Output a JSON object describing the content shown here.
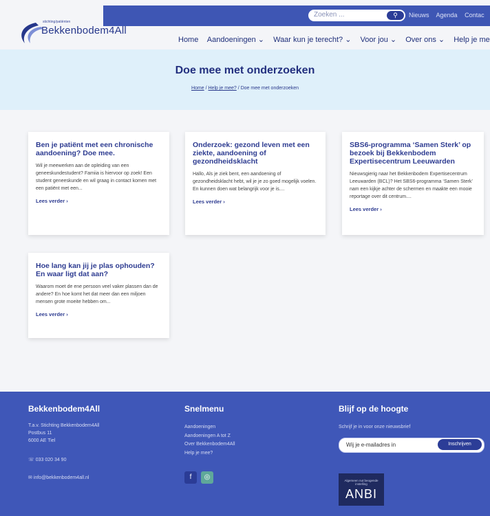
{
  "header": {
    "search_placeholder": "Zoeken ...",
    "top_links": [
      "Nieuws",
      "Agenda",
      "Contac"
    ],
    "logo_sub": "stichting/patiënten",
    "logo_text": "Bekkenbodem4All",
    "nav": [
      "Home",
      "Aandoeningen ⌄",
      "Waar kun je terecht? ⌄",
      "Voor jou ⌄",
      "Over ons ⌄",
      "Help je mee?"
    ]
  },
  "hero": {
    "title": "Doe mee met onderzoeken",
    "breadcrumb": {
      "home": "Home",
      "sep1": " / ",
      "help": "Help je mee?",
      "current": " / Doe mee met onderzoeken"
    }
  },
  "cards": [
    {
      "title": "Ben je patiënt met een chronische aandoening? Doe mee.",
      "text": "Wil je meewerken aan de opleiding van een geneeskundestudent? Famiia is hiervoor op zoek! Een student geneeskunde en wil graag in contact komen met een patiënt met een...",
      "link": "Lees verder ›"
    },
    {
      "title": "Onderzoek: gezond leven met een ziekte, aandoening of gezondheidsklacht",
      "text": "Hallo, Als je ziek bent, een aandoening of gezondheidsklacht hebt, wil je je zo goed mogelijk voelen. En kunnen doen wat belangrijk voor je is....",
      "link": "Lees verder ›"
    },
    {
      "title": "SBS6-programma ‘Samen Sterk’ op bezoek bij Bekkenbodem Expertisecentrum Leeuwarden",
      "text": "Nieuwsgierig naar het Bekkenbodem Expertisecentrum Leeuwarden (BCL)? Het SBS6-programma ‘Samen Sterk’ nam een kijkje achter de schermen en maakte een mooie reportage over dit centrum....",
      "link": "Lees verder ›"
    },
    {
      "title": "Hoe lang kan jij je plas ophouden?En waar ligt dat aan?",
      "text": "Waarom moet de ene persoon veel vaker plassen dan de andere? En hoe komt het dat meer dan een miljoen mensen grote moeite hebben om...",
      "link": "Lees verder ›"
    }
  ],
  "footer": {
    "col1": {
      "title": "Bekkenbodem4All",
      "lines": [
        "T.a.v. Stichting Bekkenbodem4All",
        "Postbus 11",
        "6000 AE Tiel"
      ],
      "phone": "☏ 033 020 34 90",
      "email": "✉ info@bekkenbodem4all.nl"
    },
    "col2": {
      "title": "Snelmenu",
      "links": [
        "Aandoeningen",
        "Aandoeningen A tot Z",
        "Over Bekkenbodem4All",
        "Help je mee?"
      ],
      "social": [
        "f",
        "◎"
      ]
    },
    "col3": {
      "title": "Blijf op de hoogte",
      "subtitle": "Schrijf je in voor onze nieuwsbrief",
      "input_value": "Wij je e-mailadres in",
      "button": "Inschrijven",
      "anbi_small": "Algemeen nut beogende instelling",
      "anbi_big": "ANBI"
    }
  },
  "colors": {
    "brand": "#3e56b4",
    "hero_bg": "#dff0fa",
    "footer_bg": "#3f57b8",
    "title": "#23307f"
  }
}
